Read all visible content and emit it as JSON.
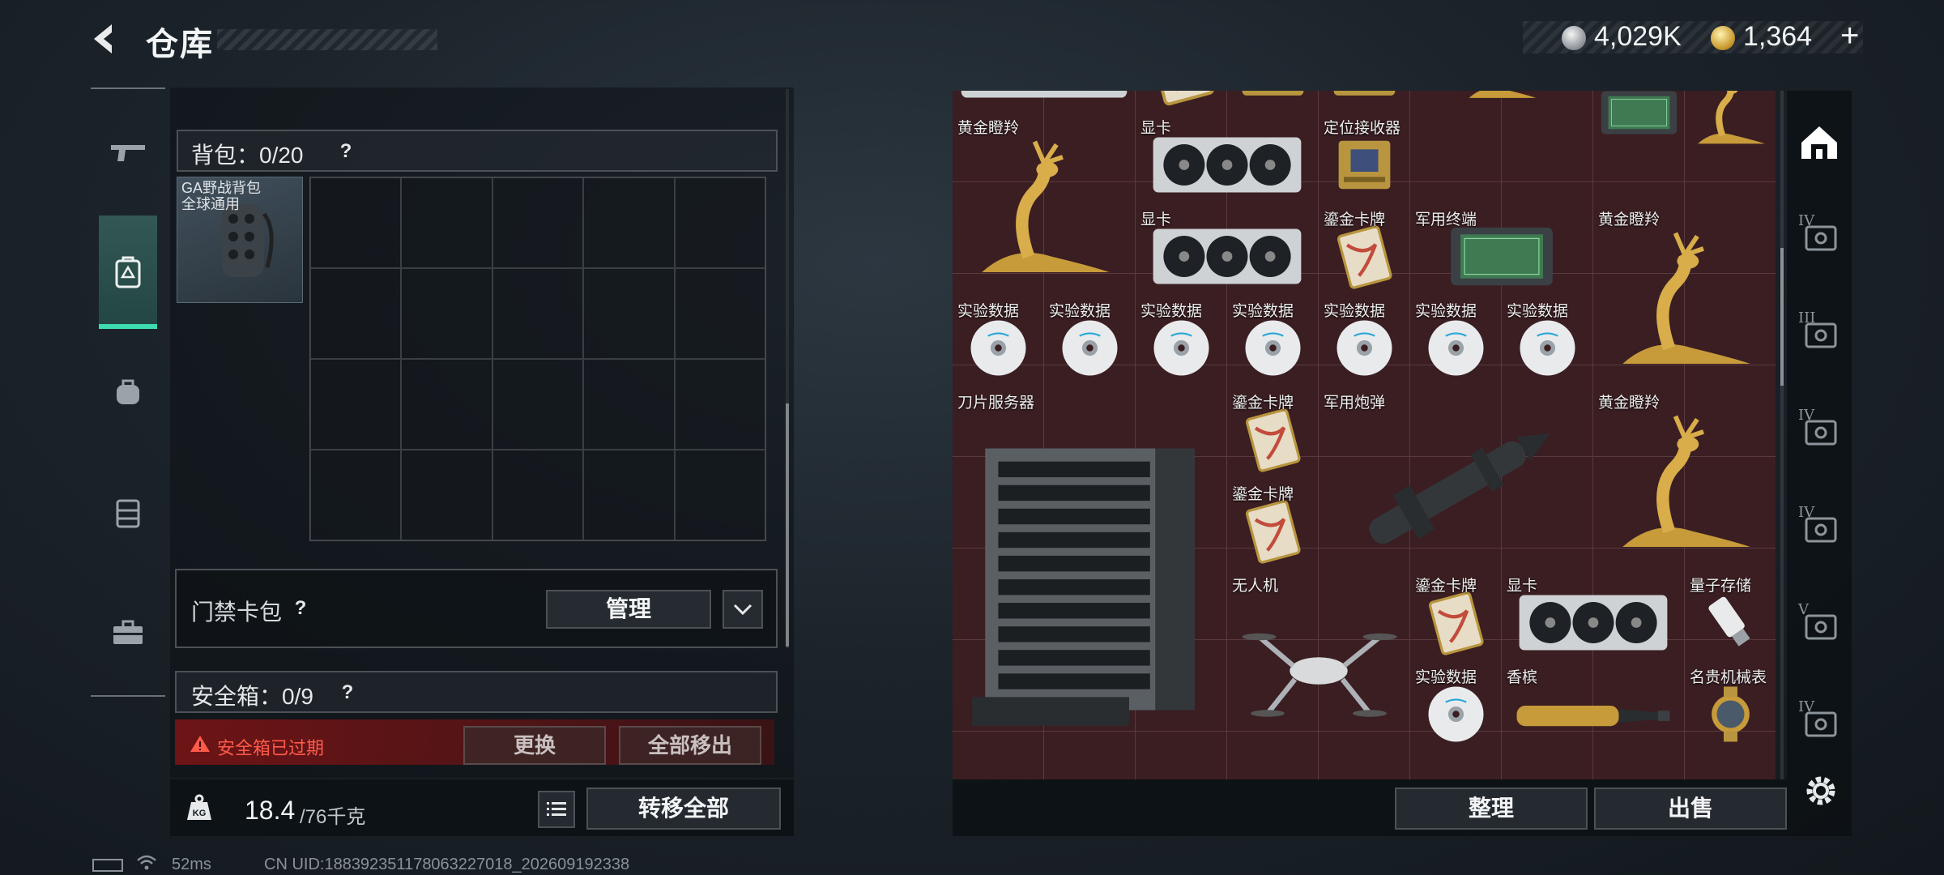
{
  "header": {
    "title": "仓库",
    "currency_silver": "4,029K",
    "currency_gold": "1,364",
    "add_currency_symbol": "+"
  },
  "left_nav": {
    "items": [
      "gun-icon",
      "backpack-equip-icon",
      "bag-icon",
      "vest-icon",
      "toolbox-icon"
    ],
    "active_index": 1
  },
  "backpack": {
    "label": "背包：0/20",
    "help": "?",
    "equipped_name_line1": "GA野战背包",
    "equipped_name_line2": "全球通用"
  },
  "keycard": {
    "label": "门禁卡包",
    "help": "?",
    "manage_label": "管理"
  },
  "safe_box": {
    "label": "安全箱：0/9",
    "help": "?",
    "warning": "安全箱已过期",
    "replace_label": "更换",
    "move_all_out_label": "全部移出"
  },
  "weight": {
    "current": "18.4",
    "max": "/76千克",
    "transfer_all_label": "转移全部"
  },
  "storage": {
    "items": [
      {
        "label": "黄金瞪羚",
        "icon": "golden-gazelle"
      },
      {
        "label": "显卡",
        "icon": "graphics-card"
      },
      {
        "label": "定位接收器",
        "icon": "gps-receiver"
      },
      {
        "label": "显卡",
        "icon": "graphics-card"
      },
      {
        "label": "鎏金卡牌",
        "icon": "gilded-card"
      },
      {
        "label": "军用终端",
        "icon": "military-terminal"
      },
      {
        "label": "黄金瞪羚",
        "icon": "golden-gazelle"
      },
      {
        "label": "实验数据",
        "icon": "data-disc"
      },
      {
        "label": "实验数据",
        "icon": "data-disc"
      },
      {
        "label": "实验数据",
        "icon": "data-disc"
      },
      {
        "label": "实验数据",
        "icon": "data-disc"
      },
      {
        "label": "实验数据",
        "icon": "data-disc"
      },
      {
        "label": "实验数据",
        "icon": "data-disc"
      },
      {
        "label": "实验数据",
        "icon": "data-disc"
      },
      {
        "label": "刀片服务器",
        "icon": "blade-server"
      },
      {
        "label": "鎏金卡牌",
        "icon": "gilded-card"
      },
      {
        "label": "军用炮弹",
        "icon": "military-shell"
      },
      {
        "label": "黄金瞪羚",
        "icon": "golden-gazelle"
      },
      {
        "label": "鎏金卡牌",
        "icon": "gilded-card"
      },
      {
        "label": "无人机",
        "icon": "drone"
      },
      {
        "label": "鎏金卡牌",
        "icon": "gilded-card"
      },
      {
        "label": "显卡",
        "icon": "graphics-card"
      },
      {
        "label": "量子存储",
        "icon": "quantum-storage"
      },
      {
        "label": "实验数据",
        "icon": "data-disc"
      },
      {
        "label": "香槟",
        "icon": "champagne"
      },
      {
        "label": "名贵机械表",
        "icon": "luxury-watch"
      }
    ],
    "sort_label": "整理",
    "sell_label": "出售"
  },
  "right_rail": {
    "items": [
      "IV",
      "III",
      "IV",
      "IV",
      "V",
      "IV"
    ]
  },
  "status": {
    "ping": "52ms",
    "uid": "CN UID:18839235117806322701​8_202609192338"
  },
  "colors": {
    "accent": "#3ddbb0",
    "storage_bg": "#3a1e22",
    "warning": "#ff5a4a"
  }
}
